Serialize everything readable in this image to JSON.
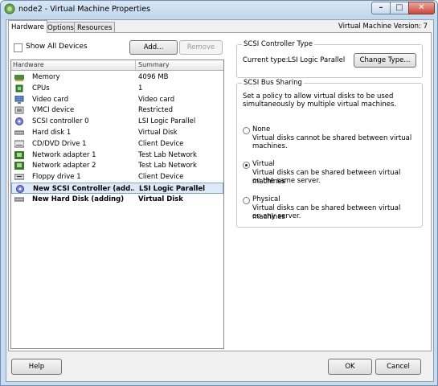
{
  "window": {
    "title": "node2 - Virtual Machine Properties",
    "controls": {
      "minimize": "–",
      "maximize": "□",
      "close": "✕"
    }
  },
  "tabs": [
    {
      "label": "Hardware",
      "active": true
    },
    {
      "label": "Options",
      "active": false
    },
    {
      "label": "Resources",
      "active": false
    }
  ],
  "vm_version": "Virtual Machine Version: 7",
  "hardware_panel": {
    "show_all_devices_label": "Show All Devices",
    "show_all_devices_checked": false,
    "add_button": "Add...",
    "remove_button": "Remove",
    "columns": {
      "hardware": "Hardware",
      "summary": "Summary"
    },
    "rows": [
      {
        "icon": "memory-icon",
        "name": "Memory",
        "summary": "4096 MB"
      },
      {
        "icon": "cpu-icon",
        "name": "CPUs",
        "summary": "1"
      },
      {
        "icon": "video-card-icon",
        "name": "Video card",
        "summary": "Video card"
      },
      {
        "icon": "vmci-device-icon",
        "name": "VMCI device",
        "summary": "Restricted"
      },
      {
        "icon": "scsi-controller-icon",
        "name": "SCSI controller 0",
        "summary": "LSI Logic Parallel"
      },
      {
        "icon": "hard-disk-icon",
        "name": "Hard disk 1",
        "summary": "Virtual Disk"
      },
      {
        "icon": "cd-dvd-drive-icon",
        "name": "CD/DVD Drive 1",
        "summary": "Client Device"
      },
      {
        "icon": "network-adapter-icon",
        "name": "Network adapter 1",
        "summary": "Test Lab Network"
      },
      {
        "icon": "network-adapter-icon",
        "name": "Network adapter 2",
        "summary": "Test Lab Network"
      },
      {
        "icon": "floppy-drive-icon",
        "name": "Floppy drive 1",
        "summary": "Client Device"
      },
      {
        "icon": "scsi-controller-icon",
        "name": "New SCSI Controller (add...",
        "summary": "LSI Logic Parallel",
        "selected": true,
        "bold": true
      },
      {
        "icon": "hard-disk-icon",
        "name": "New Hard Disk (adding)",
        "summary": "Virtual Disk",
        "bold": true
      }
    ]
  },
  "scsi_controller_type": {
    "title": "SCSI Controller Type",
    "current_type_label": "Current type:",
    "current_type_value": "LSI Logic Parallel",
    "change_type_button": "Change Type..."
  },
  "scsi_bus_sharing": {
    "title": "SCSI Bus Sharing",
    "description_line1": "Set a policy to allow virtual disks to be used",
    "description_line2": "simultaneously by multiple virtual machines.",
    "selected": "Virtual",
    "options": [
      {
        "label": "None",
        "line1": "Virtual disks cannot be shared between virtual",
        "line2": "machines."
      },
      {
        "label": "Virtual",
        "line1": "Virtual disks can be shared between virtual machines",
        "line2": "on the same server."
      },
      {
        "label": "Physical",
        "line1": "Virtual disks can be shared between virtual machines",
        "line2": "on any server."
      }
    ]
  },
  "footer": {
    "help_button": "Help",
    "ok_button": "OK",
    "cancel_button": "Cancel"
  }
}
